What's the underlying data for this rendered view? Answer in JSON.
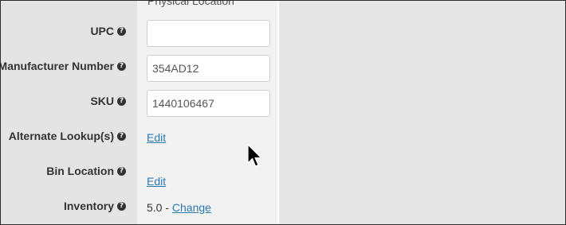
{
  "header": {
    "cut_label": "Physical Location"
  },
  "fields": {
    "upc": {
      "label": "UPC",
      "value": ""
    },
    "manufacturer_number": {
      "label": "Manufacturer Number",
      "value": "354AD12"
    },
    "sku": {
      "label": "SKU",
      "value": "1440106467"
    },
    "alternate_lookups": {
      "label": "Alternate Lookup(s)",
      "link": "Edit"
    },
    "bin_location": {
      "label": "Bin Location",
      "link": "Edit"
    },
    "inventory": {
      "label": "Inventory",
      "value": "5.0 - ",
      "link": "Change"
    }
  },
  "help_glyph": "?",
  "icons": {
    "help": "question-circle-icon",
    "cursor": "mouse-pointer-icon"
  },
  "colors": {
    "link": "#2a7ab0",
    "label_bg": "#e4e4e4",
    "field_bg": "#f2f2f2",
    "outer_bg": "#e6e6e6"
  }
}
